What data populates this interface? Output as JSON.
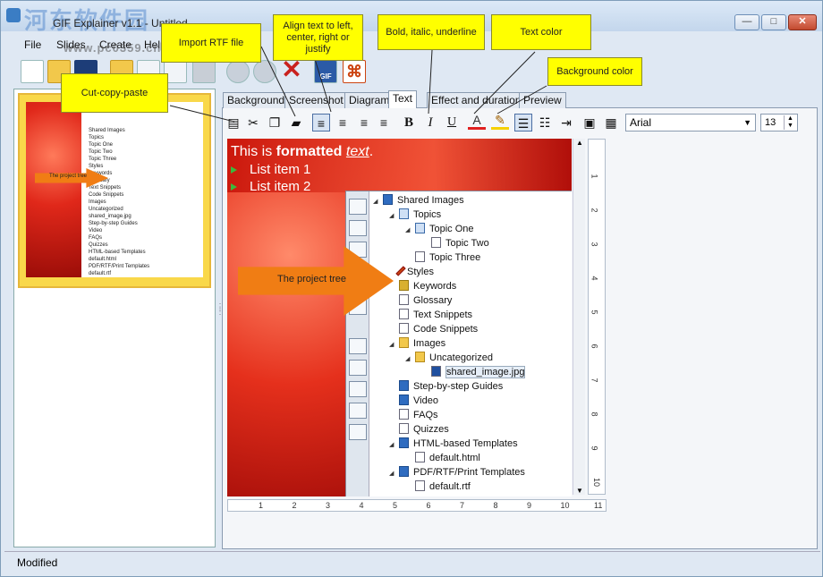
{
  "window": {
    "title": "GIF Explainer v1.1 - Untitled",
    "watermark": "河东软件园",
    "watermark_url": "www.pc0359.cn",
    "buttons": {
      "minimize": "—",
      "maximize": "□",
      "close": "✕"
    }
  },
  "menu": [
    "File",
    "Slides",
    "Create",
    "Help"
  ],
  "toolbar": {
    "gif_label": "GIF",
    "pdf_label": "⌘"
  },
  "callouts": {
    "cut_copy_paste": "Cut-copy-paste",
    "import_rtf": "Import RTF file",
    "align": "Align text to left, center, right or justify",
    "bold_italic": "Bold, italic, underline",
    "text_color": "Text color",
    "background_color": "Background color"
  },
  "thumbnail": {
    "arrow_label": "The project tree",
    "tree": [
      "Shared Images",
      "Topics",
      "Topic One",
      "Topic Two",
      "Topic Three",
      "Styles",
      "Keywords",
      "Glossary",
      "Text Snippets",
      "Code Snippets",
      "Images",
      "Uncategorized",
      "shared_image.jpg",
      "Step-by-step Guides",
      "Video",
      "FAQs",
      "Quizzes",
      "HTML-based Templates",
      "default.html",
      "PDF/RTF/Print Templates",
      "default.rtf"
    ]
  },
  "tabs": [
    "Background",
    "Screenshot",
    "Diagram",
    "Text",
    "Effect and duration",
    "Preview"
  ],
  "active_tab": "Text",
  "format": {
    "bold": "B",
    "italic": "I",
    "underline": "U",
    "font_color_glyph": "A",
    "bg_color_glyph": "✎",
    "font_name": "Arial",
    "font_size": "13",
    "text_color": "#e02020",
    "highlight_color": "#f6d000"
  },
  "slide": {
    "title_plain": "This is ",
    "title_bold": "formatted",
    "title_italic": "text",
    "title_end": ".",
    "list": [
      "List item 1",
      "List item 2"
    ],
    "arrow_label": "The project tree",
    "tree": [
      {
        "label": "Shared Images",
        "level": 0,
        "icon": "blue",
        "exp": "◢"
      },
      {
        "label": "Topics",
        "level": 1,
        "icon": "book",
        "exp": "◢"
      },
      {
        "label": "Topic One",
        "level": 2,
        "icon": "book",
        "exp": "◢"
      },
      {
        "label": "Topic Two",
        "level": 3,
        "icon": "doc",
        "exp": ""
      },
      {
        "label": "Topic Three",
        "level": 2,
        "icon": "doc",
        "exp": ""
      },
      {
        "label": "Styles",
        "level": 1,
        "icon": "pen",
        "exp": ""
      },
      {
        "label": "Keywords",
        "level": 1,
        "icon": "key",
        "exp": ""
      },
      {
        "label": "Glossary",
        "level": 1,
        "icon": "doc",
        "exp": ""
      },
      {
        "label": "Text Snippets",
        "level": 1,
        "icon": "doc",
        "exp": ""
      },
      {
        "label": "Code Snippets",
        "level": 1,
        "icon": "doc",
        "exp": ""
      },
      {
        "label": "Images",
        "level": 1,
        "icon": "folder",
        "exp": "◢"
      },
      {
        "label": "Uncategorized",
        "level": 2,
        "icon": "folder",
        "exp": "◢"
      },
      {
        "label": "shared_image.jpg",
        "level": 3,
        "icon": "sel",
        "exp": ""
      },
      {
        "label": "Step-by-step Guides",
        "level": 1,
        "icon": "blue",
        "exp": ""
      },
      {
        "label": "Video",
        "level": 1,
        "icon": "blue",
        "exp": ""
      },
      {
        "label": "FAQs",
        "level": 1,
        "icon": "doc",
        "exp": ""
      },
      {
        "label": "Quizzes",
        "level": 1,
        "icon": "doc",
        "exp": ""
      },
      {
        "label": "HTML-based Templates",
        "level": 1,
        "icon": "blue",
        "exp": "◢"
      },
      {
        "label": "default.html",
        "level": 2,
        "icon": "doc",
        "exp": ""
      },
      {
        "label": "PDF/RTF/Print Templates",
        "level": 1,
        "icon": "blue",
        "exp": "◢"
      },
      {
        "label": "default.rtf",
        "level": 2,
        "icon": "doc",
        "exp": ""
      }
    ]
  },
  "vruler": [
    "1",
    "2",
    "3",
    "4",
    "5",
    "6",
    "7",
    "8",
    "9",
    "10"
  ],
  "hruler": [
    "1",
    "2",
    "3",
    "4",
    "5",
    "6",
    "7",
    "8",
    "9",
    "10",
    "11"
  ],
  "status": "Modified"
}
